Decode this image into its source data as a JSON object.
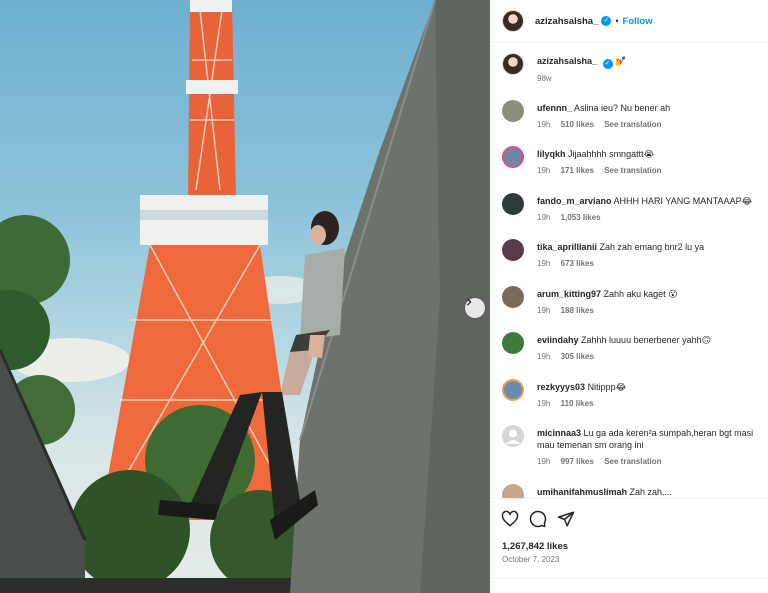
{
  "post": {
    "author": "azizahsalsha_",
    "follow_label": "Follow",
    "dot": "•",
    "caption_emoji": "💅",
    "caption_age": "98w",
    "likes": "1,267,842 likes",
    "date": "October 7, 2023"
  },
  "comments": [
    {
      "user": "ufennn_",
      "text": "Aslina ieu? Nu bener ah",
      "age": "19h",
      "likes": "510 likes",
      "translation": "See translation",
      "avatar_color": "#8a8f7a"
    },
    {
      "user": "lilyqkh",
      "text": "Jijaahhhh smngattt😭",
      "age": "19h",
      "likes": "171 likes",
      "translation": "See translation",
      "avatar_color": "#6f86a6"
    },
    {
      "user": "fando_m_arviano",
      "text": "AHHH HARI YANG MANTAAAP😂",
      "age": "19h",
      "likes": "1,053 likes",
      "translation": "",
      "avatar_color": "#2e3b3a"
    },
    {
      "user": "tika_aprillianii",
      "text": "Zah zah emang bnr2 lu ya",
      "age": "19h",
      "likes": "673 likes",
      "translation": "",
      "avatar_color": "#5a3a4a"
    },
    {
      "user": "arum_kitting97",
      "text": "Zahh aku kaget 😮",
      "age": "19h",
      "likes": "188 likes",
      "translation": "",
      "avatar_color": "#7a6a5a"
    },
    {
      "user": "eviindahy",
      "text": "Zahhh luuuu benerbener yahh🙃",
      "age": "19h",
      "likes": "305 likes",
      "translation": "",
      "avatar_color": "#3e7a3a"
    },
    {
      "user": "rezkyyys03",
      "text": "Nitippp😂",
      "age": "19h",
      "likes": "110 likes",
      "translation": "",
      "avatar_color": "#6a8ab0"
    },
    {
      "user": "micinnaa3",
      "text": "Lu ga ada keren²a sumpah,heran bgt masi mau temenan sm orang ini",
      "age": "19h",
      "likes": "997 likes",
      "translation": "See translation",
      "avatar_color": "#d0d0d0"
    },
    {
      "user": "umihanifahmuslimah",
      "text": "Zah zah....",
      "age": "",
      "likes": "",
      "translation": "",
      "avatar_color": "#c9a58a"
    }
  ],
  "icons": {
    "like": "heart-icon",
    "comment": "comment-icon",
    "share": "share-icon",
    "next": "chevron-right-icon"
  },
  "colors": {
    "accent": "#0095f6",
    "text": "#262626",
    "muted": "#737373",
    "tower": "#e8623a"
  }
}
